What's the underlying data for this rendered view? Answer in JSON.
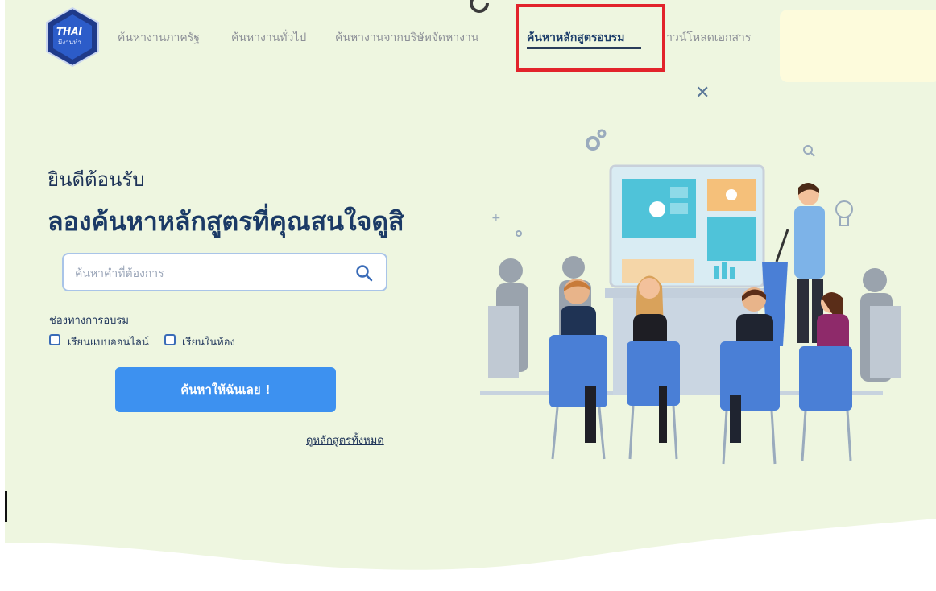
{
  "logo": {
    "line1": "THAI",
    "line2": "มีงานทำ"
  },
  "nav": {
    "items": [
      {
        "label": "ค้นหางานภาครัฐ"
      },
      {
        "label": "ค้นหางานทั่วไป"
      },
      {
        "label": "ค้นหางานจากบริษัทจัดหางาน"
      },
      {
        "label": "ค้นหาหลักสูตรอบรม"
      },
      {
        "label": "ดาวน์โหลดเอกสาร"
      }
    ],
    "active_index": 3
  },
  "hero": {
    "welcome": "ยินดีต้อนรับ",
    "headline": "ลองค้นหาหลักสูตรที่คุณสนใจดูสิ"
  },
  "search": {
    "placeholder": "ค้นหาคำที่ต้องการ",
    "value": ""
  },
  "channel": {
    "label": "ช่องทางการอบรม",
    "options": [
      {
        "label": "เรียนแบบออนไลน์",
        "checked": false
      },
      {
        "label": "เรียนในห้อง",
        "checked": false
      }
    ]
  },
  "search_button": {
    "label": "ค้นหาให้ฉันเลย !"
  },
  "all_courses_link": {
    "label": "ดูหลักสูตรทั้งหมด"
  },
  "colors": {
    "background": "#eef6e0",
    "primary_button": "#3d91f0",
    "heading": "#1b3a66",
    "highlight": "#e2232b"
  }
}
